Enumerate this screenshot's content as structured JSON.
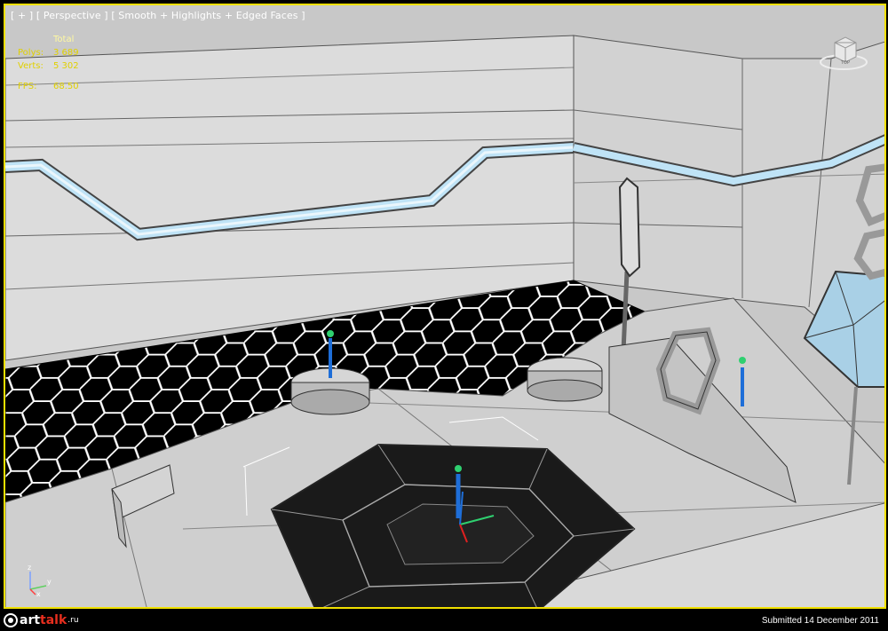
{
  "viewport": {
    "label_plus": "[ + ]",
    "label_view": "[ Perspective ]",
    "label_shading": "[ Smooth + Highlights + Edged Faces ]"
  },
  "stats": {
    "header": "Total",
    "polys_label": "Polys:",
    "polys_value": "3 689",
    "verts_label": "Verts:",
    "verts_value": "5 302",
    "fps_label": "FPS:",
    "fps_value": "68.50"
  },
  "viewcube": {
    "icon": "viewcube-icon",
    "face_label": "TOP"
  },
  "axis": {
    "x": "x",
    "y": "y",
    "z": "z"
  },
  "footer": {
    "logo_main": "art",
    "logo_accent": "talk",
    "logo_suffix": ".ru",
    "submitted": "Submitted 14 December 2011"
  },
  "colors": {
    "viewport_border": "#f0e000",
    "stats_text": "#e0d000",
    "stripe": "#a8d8f0",
    "floor": "#000000",
    "hex_line": "#ffffff",
    "wall": "#d8d8d8",
    "logo_accent": "#e62e1e"
  }
}
